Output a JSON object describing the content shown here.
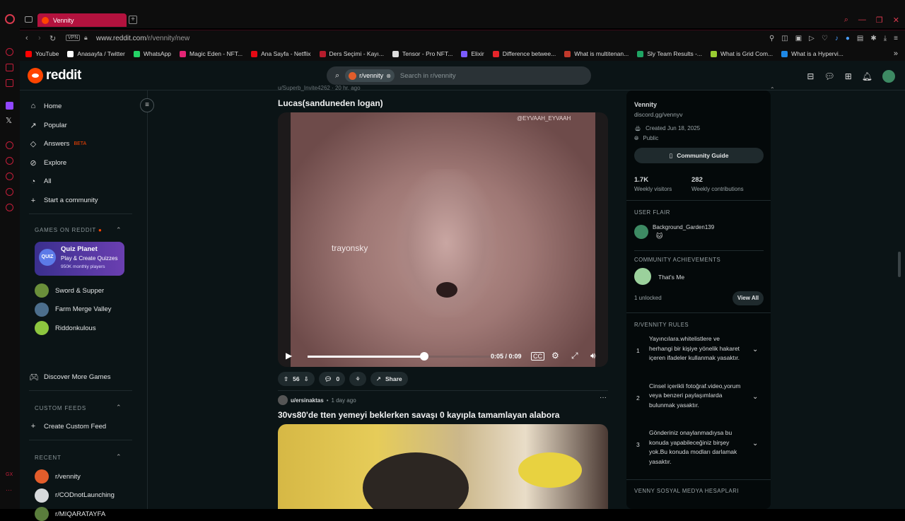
{
  "browser": {
    "tab_title": "Vennity",
    "url_host": "www.reddit.com",
    "url_path": "/r/vennity/new",
    "vpn_label": "VPN",
    "bookmarks": [
      {
        "label": "YouTube",
        "color": "#ff0000"
      },
      {
        "label": "Anasayfa / Twitter",
        "color": "#ffffff"
      },
      {
        "label": "WhatsApp",
        "color": "#25d366"
      },
      {
        "label": "Magic Eden - NFT...",
        "color": "#e42575"
      },
      {
        "label": "Ana Sayfa - Netflix",
        "color": "#e50914"
      },
      {
        "label": "Ders Seçimi - Kayı...",
        "color": "#b51c2c"
      },
      {
        "label": "Tensor - Pro NFT...",
        "color": "#dddddd"
      },
      {
        "label": "Elixir",
        "color": "#7b5cff"
      },
      {
        "label": "Difference betwee...",
        "color": "#e5252a"
      },
      {
        "label": "What is multitenan...",
        "color": "#c0392b"
      },
      {
        "label": "Sly Team Results -...",
        "color": "#1fa463"
      },
      {
        "label": "What is Grid Com...",
        "color": "#9acd32"
      },
      {
        "label": "What is a Hypervi...",
        "color": "#1e88e5"
      }
    ]
  },
  "header": {
    "logo_text": "reddit",
    "search_chip": "r/vennity",
    "search_placeholder": "Search in r/vennity"
  },
  "leftnav": {
    "items": [
      {
        "label": "Home",
        "icon": "home-icon"
      },
      {
        "label": "Popular",
        "icon": "popular-icon"
      },
      {
        "label": "Answers",
        "icon": "answers-icon",
        "badge": "BETA"
      },
      {
        "label": "Explore",
        "icon": "explore-icon"
      },
      {
        "label": "All",
        "icon": "all-icon"
      },
      {
        "label": "Start a community",
        "icon": "plus-icon"
      }
    ],
    "games_title": "GAMES ON REDDIT",
    "quiz_title": "Quiz Planet",
    "quiz_sub": "Play & Create Quizzes",
    "quiz_users": "950K monthly players",
    "quiz_icon_text": "QUIZ",
    "games": [
      {
        "label": "Sword & Supper",
        "color": "#6a8f3a"
      },
      {
        "label": "Farm Merge Valley",
        "color": "#4c6e8c"
      },
      {
        "label": "Riddonkulous",
        "color": "#8dc63f"
      }
    ],
    "discover_label": "Discover More Games",
    "custom_feeds_title": "CUSTOM FEEDS",
    "create_feed_label": "Create Custom Feed",
    "recent_title": "RECENT",
    "recent": [
      {
        "label": "r/vennity",
        "color": "#e35d2b"
      },
      {
        "label": "r/CODnotLaunching",
        "color": "#d7dadc"
      },
      {
        "label": "r/MIQARATAYFA",
        "color": "#5a7d3c"
      }
    ]
  },
  "post1": {
    "meta_user": "u/Superb_Invite4262",
    "meta_time": "20 hr. ago",
    "title": "Lucas(sanduneden logan)",
    "watermark": "trayonsky",
    "watermark_top": "@EYVAAH_EYVAAH",
    "video_time": "0:05 / 0:09",
    "progress": 0.55,
    "upvotes": "56",
    "comments": "0",
    "share_label": "Share"
  },
  "post2": {
    "user": "u/ersinaktas",
    "time": "1 day ago",
    "title": "30vs80'de tten yemeyi beklerken savaşı 0 kayıpla tamamlayan alabora"
  },
  "sidebar": {
    "name": "Vennity",
    "link": "discord.gg/vennyv",
    "created": "Created Jun 18, 2025",
    "visibility": "Public",
    "guide_label": "Community Guide",
    "visitors_value": "1.7K",
    "visitors_label": "Weekly visitors",
    "contrib_value": "282",
    "contrib_label": "Weekly contributions",
    "flair_title": "USER FLAIR",
    "flair_user": "Background_Garden139",
    "achievements_title": "COMMUNITY ACHIEVEMENTS",
    "achievement": "That's Me",
    "unlocked": "1 unlocked",
    "view_all": "View All",
    "rules_title": "R/VENNITY RULES",
    "rules": [
      {
        "n": "1",
        "text": "Yayıncılara.whitelistlere ve herhangi bir kişiye yönelik hakaret içeren ifadeler kullanmak yasaktır."
      },
      {
        "n": "2",
        "text": "Cinsel içerikli fotoğraf.video,yorum veya benzeri paylaşımlarda bulunmak yasaktır."
      },
      {
        "n": "3",
        "text": "Gönderiniz onaylanmadıysa bu konuda yapabileceğiniz birşey yok.Bu konuda modları darlamak yasaktır."
      }
    ],
    "social_title": "VENNY SOSYAL MEDYA HESAPLARI"
  }
}
